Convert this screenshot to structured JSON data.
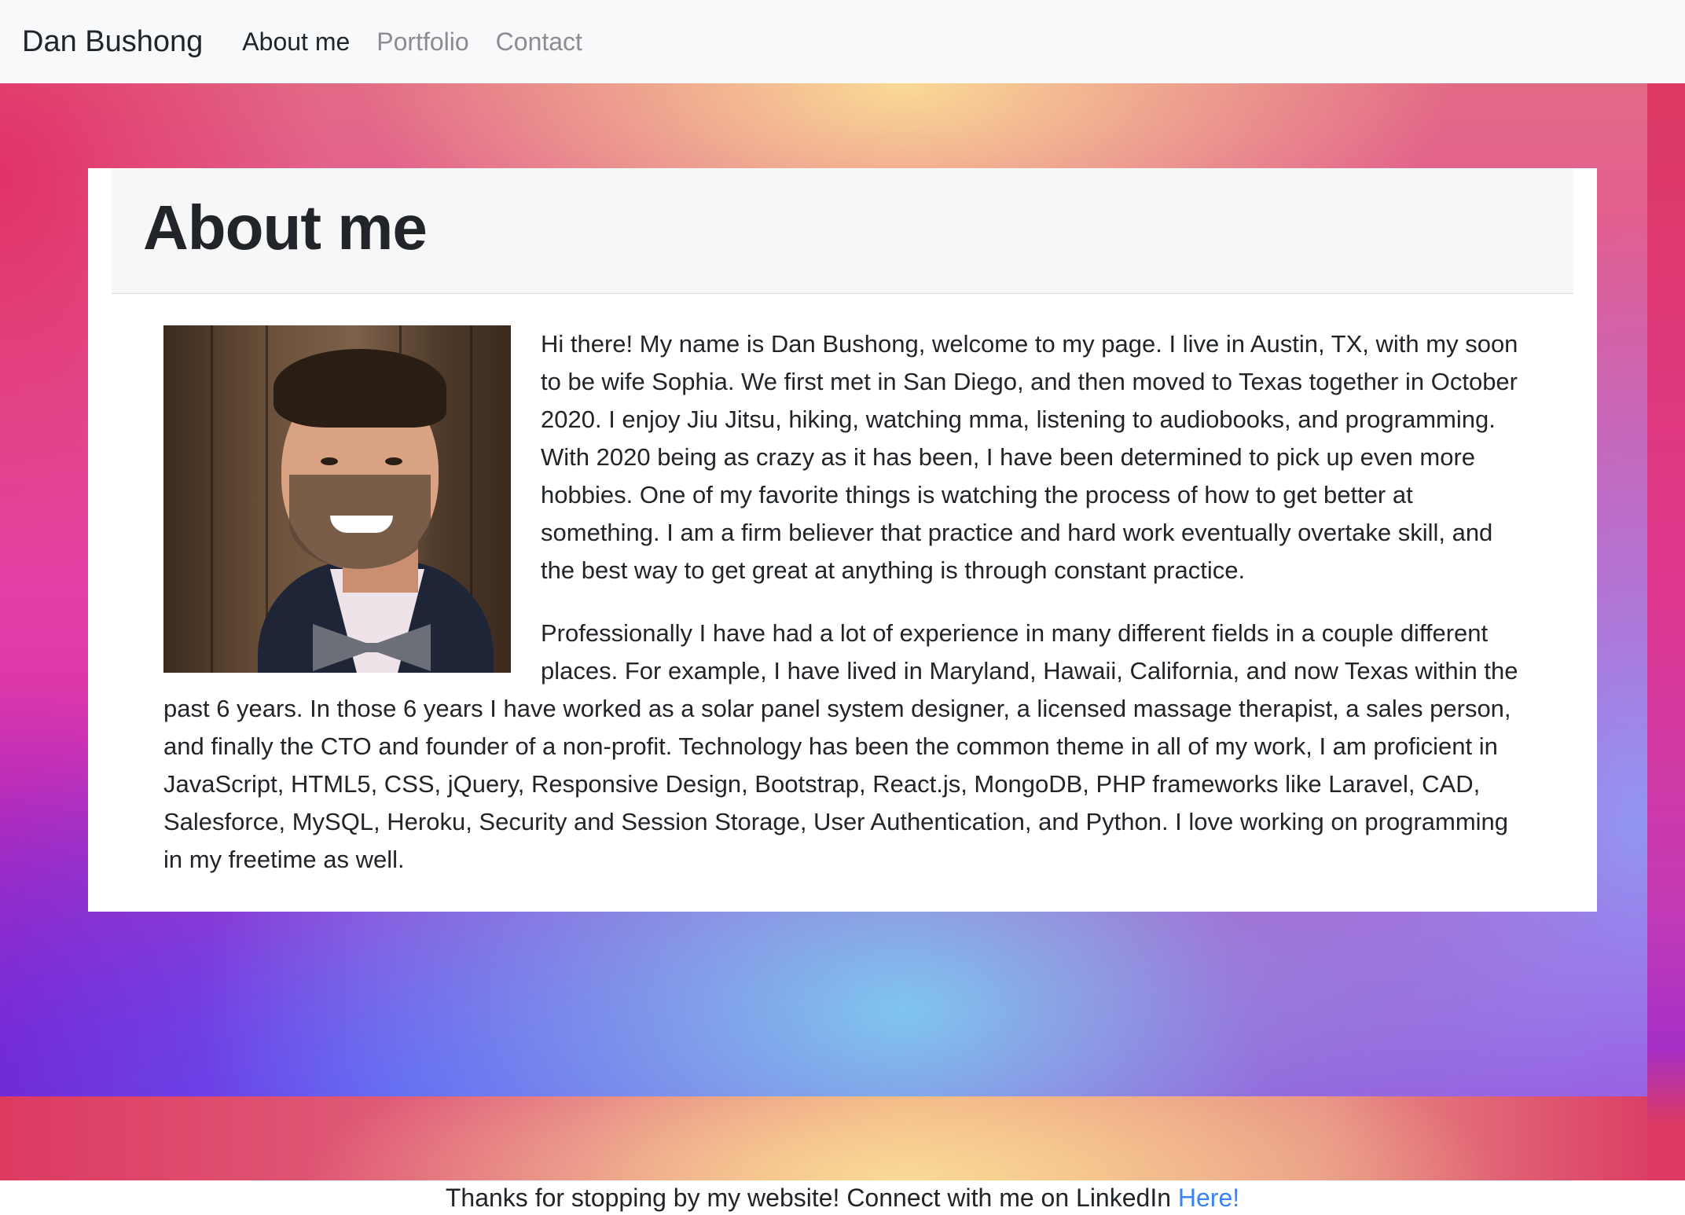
{
  "navbar": {
    "brand": "Dan Bushong",
    "links": [
      {
        "label": "About me",
        "active": true
      },
      {
        "label": "Portfolio",
        "active": false
      },
      {
        "label": "Contact",
        "active": false
      }
    ]
  },
  "card": {
    "title": "About me",
    "paragraphs": [
      "Hi there! My name is Dan Bushong, welcome to my page. I live in Austin, TX, with my soon to be wife Sophia. We first met in San Diego, and then moved to Texas together in October 2020. I enjoy Jiu Jitsu, hiking, watching mma, listening to audiobooks, and programming. With 2020 being as crazy as it has been, I have been determined to pick up even more hobbies. One of my favorite things is watching the process of how to get better at something. I am a firm believer that practice and hard work eventually overtake skill, and the best way to get great at anything is through constant practice.",
      "Professionally I have had a lot of experience in many different fields in a couple different places. For example, I have lived in Maryland, Hawaii, California, and now Texas within the past 6 years. In those 6 years I have worked as a solar panel system designer, a licensed massage therapist, a sales person, and finally the CTO and founder of a non-profit. Technology has been the common theme in all of my work, I am proficient in JavaScript, HTML5, CSS, jQuery, Responsive Design, Bootstrap, React.js, MongoDB, PHP frameworks like Laravel, CAD, Salesforce, MySQL, Heroku, Security and Session Storage, User Authentication, and Python. I love working on programming in my freetime as well."
    ]
  },
  "footer": {
    "text": "Thanks for stopping by my website! Connect with me on LinkedIn ",
    "link_label": "Here!"
  },
  "colors": {
    "link": "#3b82f6",
    "text": "#212529",
    "navbar_bg": "#f8f9fa"
  }
}
